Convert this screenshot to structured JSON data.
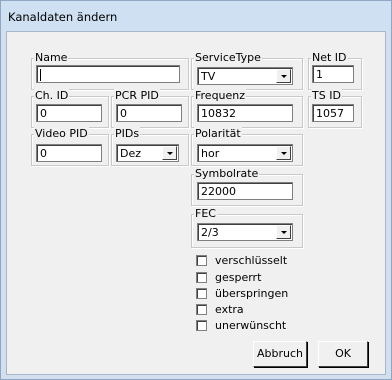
{
  "window": {
    "title": "Kanaldaten ändern"
  },
  "groups": {
    "name": {
      "label": "Name",
      "value": ""
    },
    "service_type": {
      "label": "ServiceType",
      "value": "TV"
    },
    "net_id": {
      "label": "Net ID",
      "value": "1"
    },
    "ch_id": {
      "label": "Ch. ID",
      "value": "0"
    },
    "pcr_pid": {
      "label": "PCR PID",
      "value": "0"
    },
    "frequenz": {
      "label": "Frequenz",
      "value": "10832"
    },
    "ts_id": {
      "label": "TS ID",
      "value": "1057"
    },
    "video_pid": {
      "label": "Video PID",
      "value": "0"
    },
    "pids": {
      "label": "PIDs",
      "value": "Dez"
    },
    "polaritaet": {
      "label": "Polarität",
      "value": "hor"
    },
    "symbolrate": {
      "label": "Symbolrate",
      "value": "22000"
    },
    "fec": {
      "label": "FEC",
      "value": "2/3"
    }
  },
  "checkboxes": [
    {
      "label": "verschlüsselt",
      "checked": false
    },
    {
      "label": "gesperrt",
      "checked": false
    },
    {
      "label": "überspringen",
      "checked": false
    },
    {
      "label": "extra",
      "checked": false
    },
    {
      "label": "unerwünscht",
      "checked": false
    }
  ],
  "buttons": {
    "cancel": "Abbruch",
    "ok": "OK"
  }
}
